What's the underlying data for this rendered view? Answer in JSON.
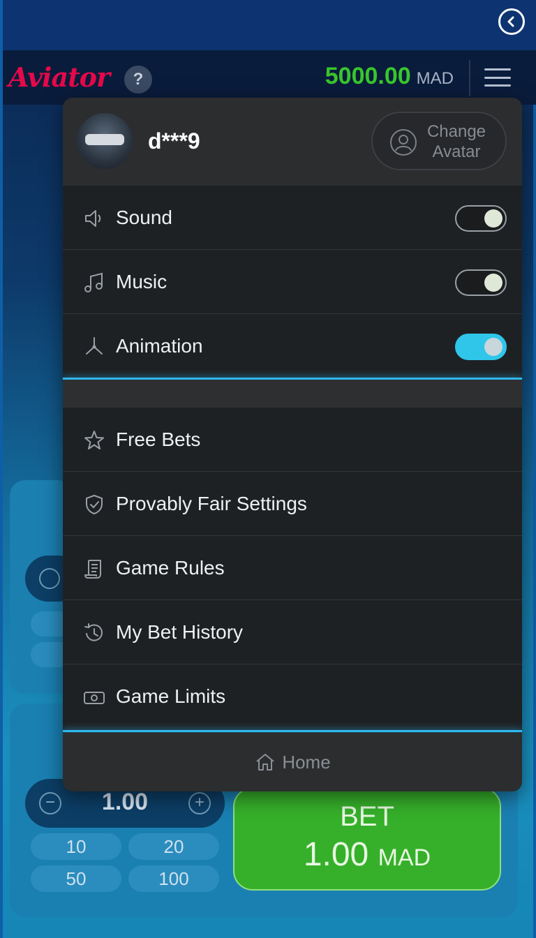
{
  "header": {
    "logo_text": "Aviator",
    "help_label": "?",
    "balance_value": "5000.00",
    "balance_currency": "MAD"
  },
  "menu": {
    "username": "d***9",
    "change_avatar_label_line1": "Change",
    "change_avatar_label_line2": "Avatar",
    "settings": [
      {
        "label": "Sound",
        "icon": "speaker-icon",
        "enabled": true
      },
      {
        "label": "Music",
        "icon": "music-note-icon",
        "enabled": true
      },
      {
        "label": "Animation",
        "icon": "propeller-icon",
        "enabled": true
      }
    ],
    "items": [
      {
        "label": "Free Bets",
        "icon": "star-icon"
      },
      {
        "label": "Provably Fair Settings",
        "icon": "shield-check-icon"
      },
      {
        "label": "Game Rules",
        "icon": "scroll-icon"
      },
      {
        "label": "My Bet History",
        "icon": "history-icon"
      },
      {
        "label": "Game Limits",
        "icon": "banknote-icon"
      }
    ],
    "home_label": "Home"
  },
  "bet_panel": {
    "amount": "1.00",
    "quick_amounts": [
      "10",
      "20",
      "50",
      "100"
    ],
    "bet_label": "BET",
    "bet_amount": "1.00",
    "bet_currency": "MAD"
  },
  "colors": {
    "balance": "#39c62c",
    "logo": "#e5094a",
    "bet_button": "#36b02a",
    "accent": "#2fb8f0"
  }
}
